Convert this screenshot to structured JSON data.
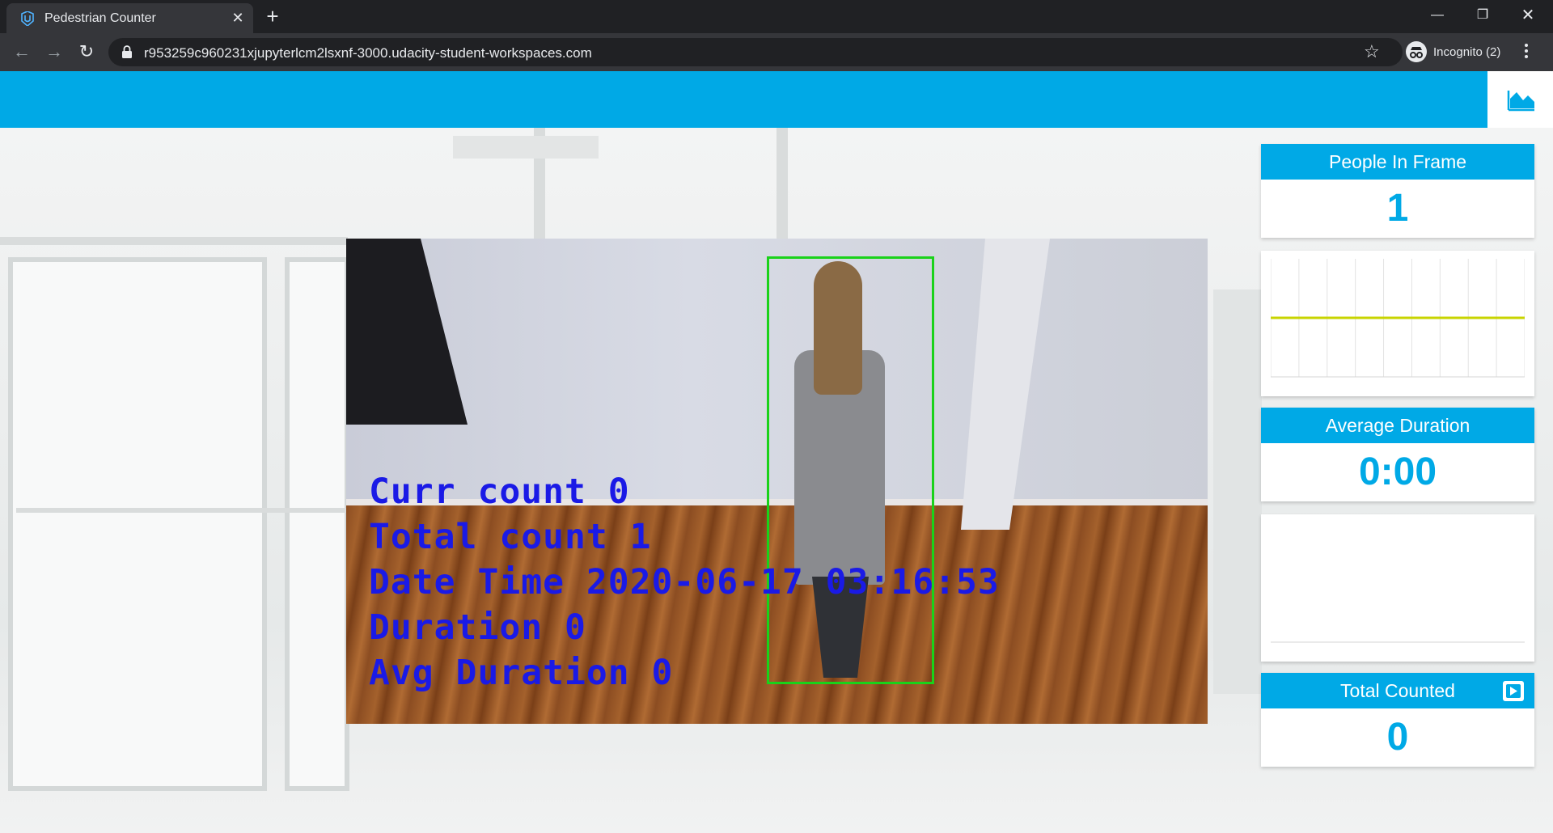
{
  "browser": {
    "tab_title": "Pedestrian Counter",
    "url": "r953259c960231xjupyterlcm2lsxnf-3000.udacity-student-workspaces.com",
    "incognito_label": "Incognito (2)"
  },
  "video": {
    "overlay": {
      "curr_count": "Curr count 0",
      "total_count": "Total count 1",
      "date_time": "Date Time 2020-06-17 03:16:53",
      "duration": "Duration 0",
      "avg_duration": "Avg Duration 0"
    }
  },
  "stats": {
    "people_in_frame": {
      "title": "People In Frame",
      "value": "1"
    },
    "average_duration": {
      "title": "Average Duration",
      "value": "0:00"
    },
    "total_counted": {
      "title": "Total Counted",
      "value": "0"
    }
  },
  "colors": {
    "accent": "#00a9e6",
    "chart_line": "#c8d400",
    "bbox": "#1ad21a",
    "overlay_text": "#1a1ae6"
  },
  "chart_data": [
    {
      "type": "line",
      "series": [
        {
          "values": [
            1,
            1,
            1,
            1,
            1,
            1,
            1,
            1,
            1,
            1
          ]
        }
      ],
      "ylim": [
        0,
        2
      ],
      "grid": true
    },
    {
      "type": "line",
      "series": [
        {
          "values": []
        }
      ],
      "grid": false
    }
  ]
}
